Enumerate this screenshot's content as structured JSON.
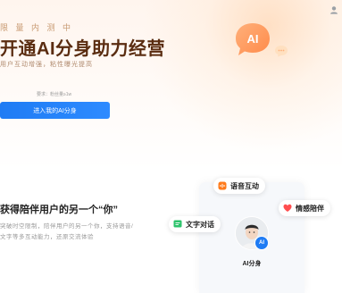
{
  "hero": {
    "eyebrow": "限 量 内 测 中",
    "headline": "开通AI分身助力经营",
    "subline": "用户互动增强，粘性曝光提高",
    "hint": "要求：粉丝量≥1w",
    "cta_label": "进入我的AI分身",
    "bubble_icon_label": "AI"
  },
  "section": {
    "title": "获得陪伴用户的另一个“你”",
    "description": "突破时空限制，陪伴用户的另一个你，支持语音/文字等多互动能力，还原交流体验"
  },
  "illustration": {
    "chips": {
      "voice": "语音互动",
      "text": "文字对话",
      "emotion": "情感陪伴"
    },
    "avatar_badge": "AI",
    "avatar_name": "AI分身"
  },
  "colors": {
    "accent_blue": "#1f7cf4",
    "headline_brown": "#5a2c10",
    "voice_orange": "#ff7a1a",
    "text_green": "#2cc36b",
    "emotion_red": "#ff4d4f"
  }
}
